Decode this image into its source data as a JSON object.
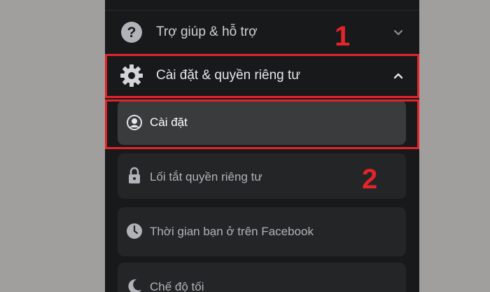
{
  "menu": {
    "help_support": {
      "label": "Trợ giúp & hỗ trợ",
      "icon": "question-circle-icon",
      "expanded": false
    },
    "settings_privacy": {
      "label": "Cài đặt & quyền riêng tư",
      "icon": "gear-icon",
      "expanded": true
    },
    "submenu": [
      {
        "label": "Cài đặt",
        "icon": "user-circle-icon"
      },
      {
        "label": "Lối tắt quyền riêng tư",
        "icon": "lock-icon"
      },
      {
        "label": "Thời gian bạn ở trên Facebook",
        "icon": "clock-icon"
      },
      {
        "label": "Chế độ tối",
        "icon": "moon-icon"
      }
    ]
  },
  "annotations": {
    "step1": "1",
    "step2": "2",
    "highlight_color": "#e3242b"
  },
  "colors": {
    "background": "#a19f9d",
    "panel": "#18191a",
    "card": "#242526",
    "card_active": "#3a3b3c",
    "text_primary": "#e4e6eb",
    "text_secondary": "#b0b3b8"
  }
}
